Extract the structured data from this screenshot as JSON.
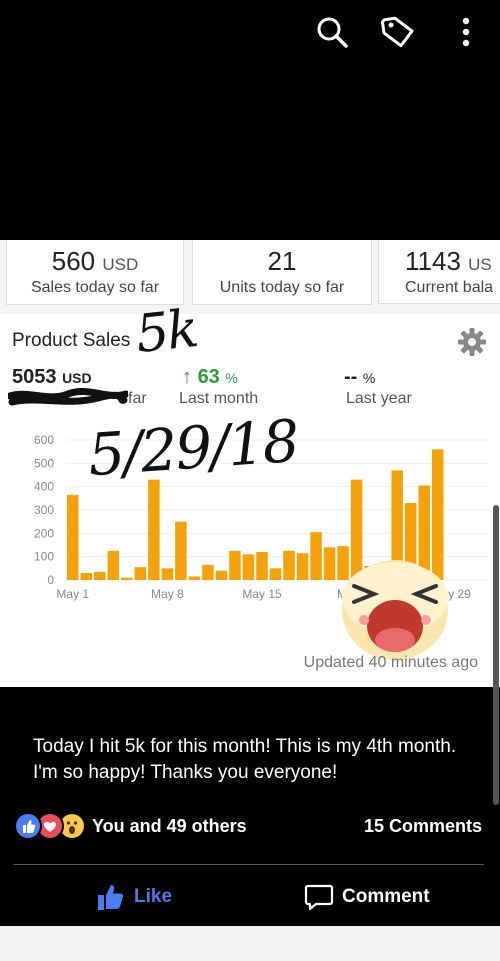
{
  "top_icons": [
    "search-icon",
    "tag-icon",
    "more-vert-icon"
  ],
  "tiles": [
    {
      "value": "560",
      "currency": "USD",
      "label": "Sales today so far"
    },
    {
      "value": "21",
      "currency": "",
      "label": "Units today so far"
    },
    {
      "value": "1143",
      "currency": "US",
      "label": "Current bala"
    }
  ],
  "product_sales": {
    "title": "Product Sales",
    "sales_value": "5053",
    "sales_currency": "USD",
    "sales_label_visible": "far",
    "month_change_arrow": "↑",
    "month_change": "63",
    "month_change_unit": "%",
    "month_label": "Last month",
    "year_change": "--",
    "year_change_unit": "%",
    "year_label": "Last year",
    "updated": "Updated 40 minutes ago"
  },
  "handwriting": {
    "amount": "5k",
    "date": "5/29/18"
  },
  "chart_data": {
    "type": "bar",
    "ylim": [
      0,
      600
    ],
    "yticks": [
      "0",
      "100",
      "200",
      "300",
      "400",
      "500",
      "600"
    ],
    "xtick_labels": [
      "May 1",
      "May 8",
      "May 15",
      "May 22",
      "May 29"
    ],
    "categories": [
      "May 1",
      "May 2",
      "May 3",
      "May 4",
      "May 5",
      "May 6",
      "May 7",
      "May 8",
      "May 9",
      "May 10",
      "May 11",
      "May 12",
      "May 13",
      "May 14",
      "May 15",
      "May 16",
      "May 17",
      "May 18",
      "May 19",
      "May 20",
      "May 21",
      "May 22",
      "May 23",
      "May 24",
      "May 25",
      "May 26",
      "May 27",
      "May 28",
      "May 29"
    ],
    "values": [
      365,
      30,
      35,
      125,
      10,
      55,
      430,
      50,
      250,
      15,
      65,
      40,
      125,
      110,
      120,
      50,
      125,
      115,
      205,
      140,
      145,
      430,
      60,
      35,
      470,
      330,
      405,
      560
    ],
    "value_count_note": "",
    "bar_color": "#f5a20a",
    "highlight_colors": [
      "#f5a20a",
      "#d6d6d6"
    ],
    "grid": true
  },
  "post": {
    "caption": "Today I hit 5k for this month! This is my 4th month. I'm so happy! Thanks you everyone!",
    "reactions_label": "You and 49 others",
    "comments_label": "15 Comments",
    "like_label": "Like",
    "comment_label": "Comment",
    "like_color": "#4a7df0"
  }
}
